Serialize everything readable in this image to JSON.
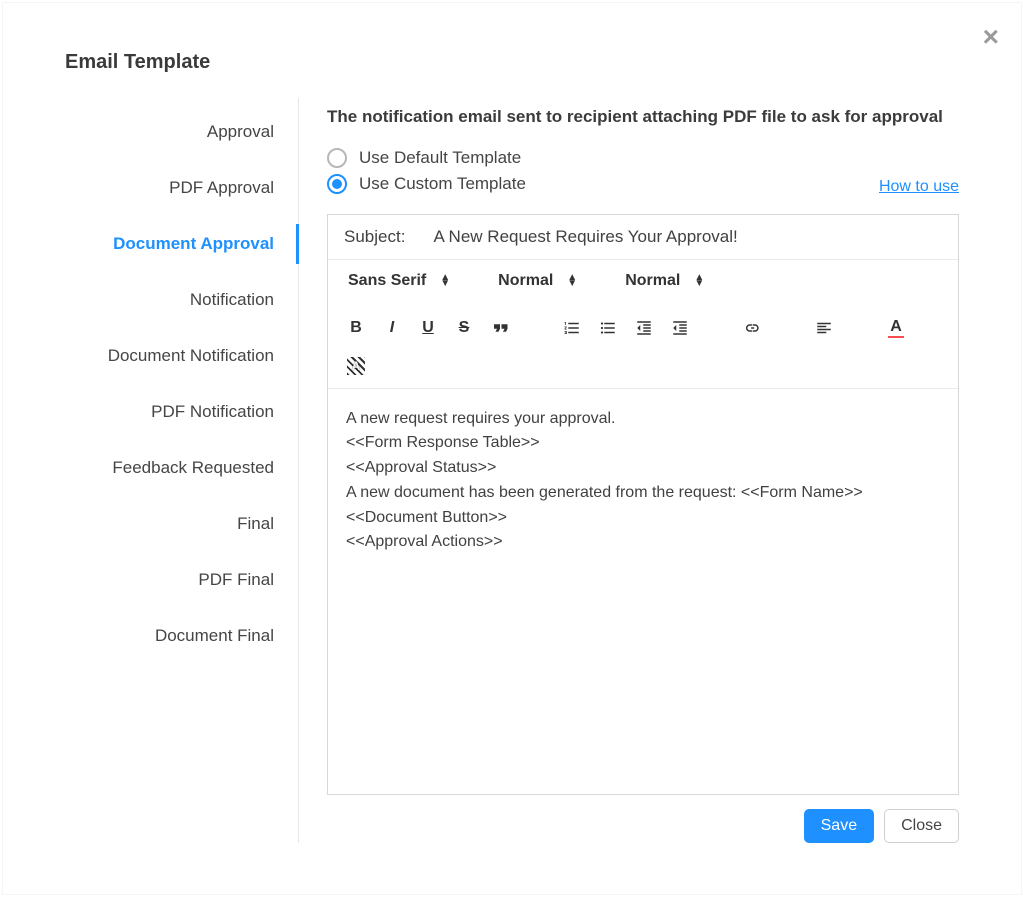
{
  "title": "Email Template",
  "close_title": "Close",
  "sidebar": {
    "items": [
      {
        "label": "Approval",
        "active": false
      },
      {
        "label": "PDF Approval",
        "active": false
      },
      {
        "label": "Document Approval",
        "active": true
      },
      {
        "label": "Notification",
        "active": false
      },
      {
        "label": "Document Notification",
        "active": false
      },
      {
        "label": "PDF Notification",
        "active": false
      },
      {
        "label": "Feedback Requested",
        "active": false
      },
      {
        "label": "Final",
        "active": false
      },
      {
        "label": "PDF Final",
        "active": false
      },
      {
        "label": "Document Final",
        "active": false
      }
    ]
  },
  "content": {
    "description": "The notification email sent to recipient attaching PDF file to ask for approval",
    "radios": {
      "default_label": "Use Default Template",
      "custom_label": "Use Custom Template",
      "selected": "custom"
    },
    "how_to_use": "How to use"
  },
  "editor": {
    "subject_label": "Subject:",
    "subject_value": "A New Request Requires Your Approval!",
    "font_family": "Sans Serif",
    "font_size": "Normal",
    "paragraph_style": "Normal",
    "body_lines": [
      "A new request requires your approval.",
      "<<Form Response Table>>",
      " <<Approval Status>>",
      "A new document has been generated from the request: <<Form Name>>",
      "<<Document Button>>",
      " <<Approval Actions>>"
    ]
  },
  "footer": {
    "save_label": "Save",
    "close_label": "Close"
  }
}
